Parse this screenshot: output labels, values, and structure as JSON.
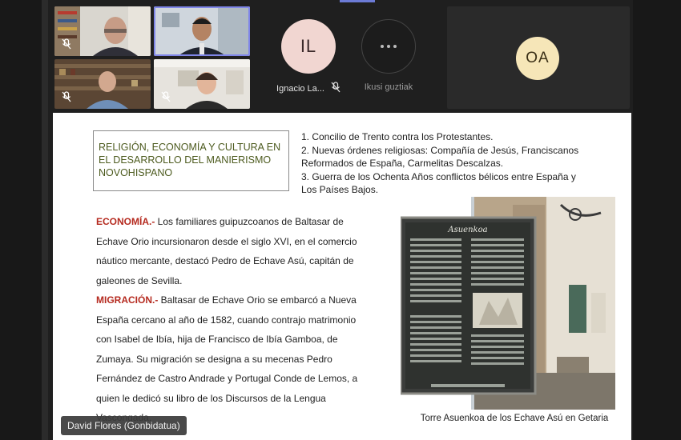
{
  "participants": {
    "tile1": {
      "muted": true
    },
    "tile2": {
      "muted": false,
      "active": true
    },
    "tile3": {
      "muted": true
    },
    "tile4": {
      "muted": true
    },
    "ignacio": {
      "initials": "IL",
      "name": "Ignacio La...",
      "avatar_color": "#f1d6d1",
      "muted": true
    },
    "more": {
      "label": "Ikusi guztiak",
      "icon": "more-dots-icon"
    },
    "oa": {
      "initials": "OA",
      "avatar_color": "#f6e6b8"
    }
  },
  "slide": {
    "title": "RELIGIÓN, ECONOMÍA Y CULTURA EN EL DESARROLLO DEL MANIERISMO NOVOHISPANO",
    "list": [
      "1. Concilio de Trento contra los Protestantes.",
      "2. Nuevas órdenes religiosas: Compañía de Jesús, Franciscanos",
      "Reformados de España, Carmelitas Descalzas.",
      "3. Guerra de los Ochenta Años conflictos bélicos entre España y",
      "Los Países Bajos."
    ],
    "economia": {
      "keyword": "ECONOMÍA.-",
      "lines": [
        " Los familiares guipuzcoanos de Baltasar de",
        "Echave Orio incursionaron desde el siglo XVI, en el comercio",
        "náutico mercante, destacó Pedro de Echave Asú, capitán de",
        "galeones de Sevilla."
      ]
    },
    "migracion": {
      "keyword": "MIGRACIÓN.-",
      "lines": [
        " Baltasar de Echave Orio se embarcó a Nueva",
        "España cercano al año de 1582, cuando contrajo matrimonio",
        "con Isabel de Ibía, hija de Francisco de Ibía Gamboa, de",
        "Zumaya. Su migración se designa a su mecenas Pedro",
        "Fernández de Castro  Andrade y Portugal Conde de Lemos, a",
        "quien le dedicó su libro de los Discursos de la Lengua",
        "Vascongada."
      ]
    },
    "plaque_title": "Asuenkoa",
    "caption": "Torre Asuenkoa de los Echave Asú en Getaria"
  },
  "speaker_tag": "David Flores (Gonbidatua)",
  "colors": {
    "title_green": "#4d5b1f",
    "keyword_red": "#b52a1f",
    "active_border": "#7f86e8"
  }
}
